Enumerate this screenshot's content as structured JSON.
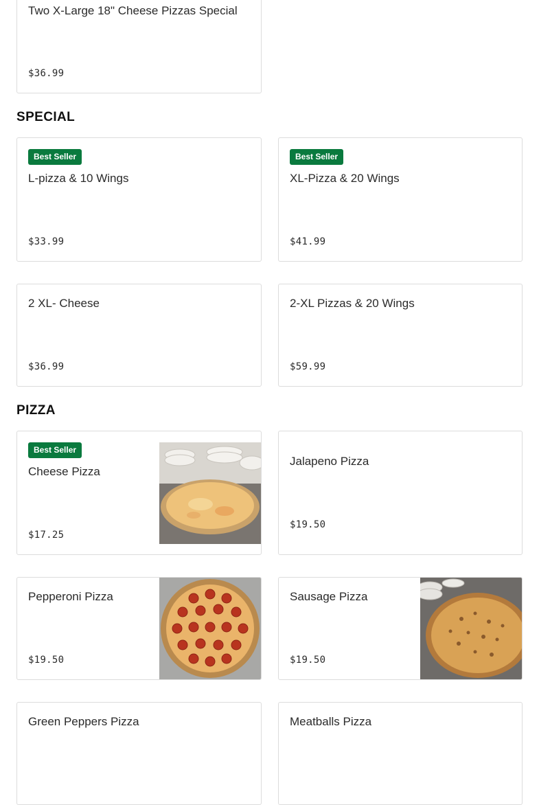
{
  "cards": {
    "two_xl_special": {
      "name": "Two X-Large 18\" Cheese Pizzas Special",
      "price": "$36.99"
    }
  },
  "sections": {
    "special": {
      "title": "SPECIAL",
      "items": [
        {
          "badge": "Best Seller",
          "name": "L-pizza & 10 Wings",
          "price": "$33.99"
        },
        {
          "badge": "Best Seller",
          "name": "XL-Pizza & 20 Wings",
          "price": "$41.99"
        },
        {
          "name": "2 XL- Cheese",
          "price": "$36.99"
        },
        {
          "name": "2-XL Pizzas & 20 Wings",
          "price": "$59.99"
        }
      ]
    },
    "pizza": {
      "title": "PIZZA",
      "items": [
        {
          "badge": "Best Seller",
          "name": "Cheese Pizza",
          "price": "$17.25",
          "image": "cheese-pizza-photo"
        },
        {
          "name": "Jalapeno Pizza",
          "price": "$19.50"
        },
        {
          "name": "Pepperoni Pizza",
          "price": "$19.50",
          "image": "pepperoni-pizza-photo"
        },
        {
          "name": "Sausage Pizza",
          "price": "$19.50",
          "image": "sausage-pizza-photo"
        },
        {
          "name": "Green Peppers Pizza"
        },
        {
          "name": "Meatballs Pizza"
        }
      ]
    }
  },
  "colors": {
    "badge_bg": "#0a7a3e",
    "card_border": "#dcdcdc",
    "text": "#191919"
  }
}
